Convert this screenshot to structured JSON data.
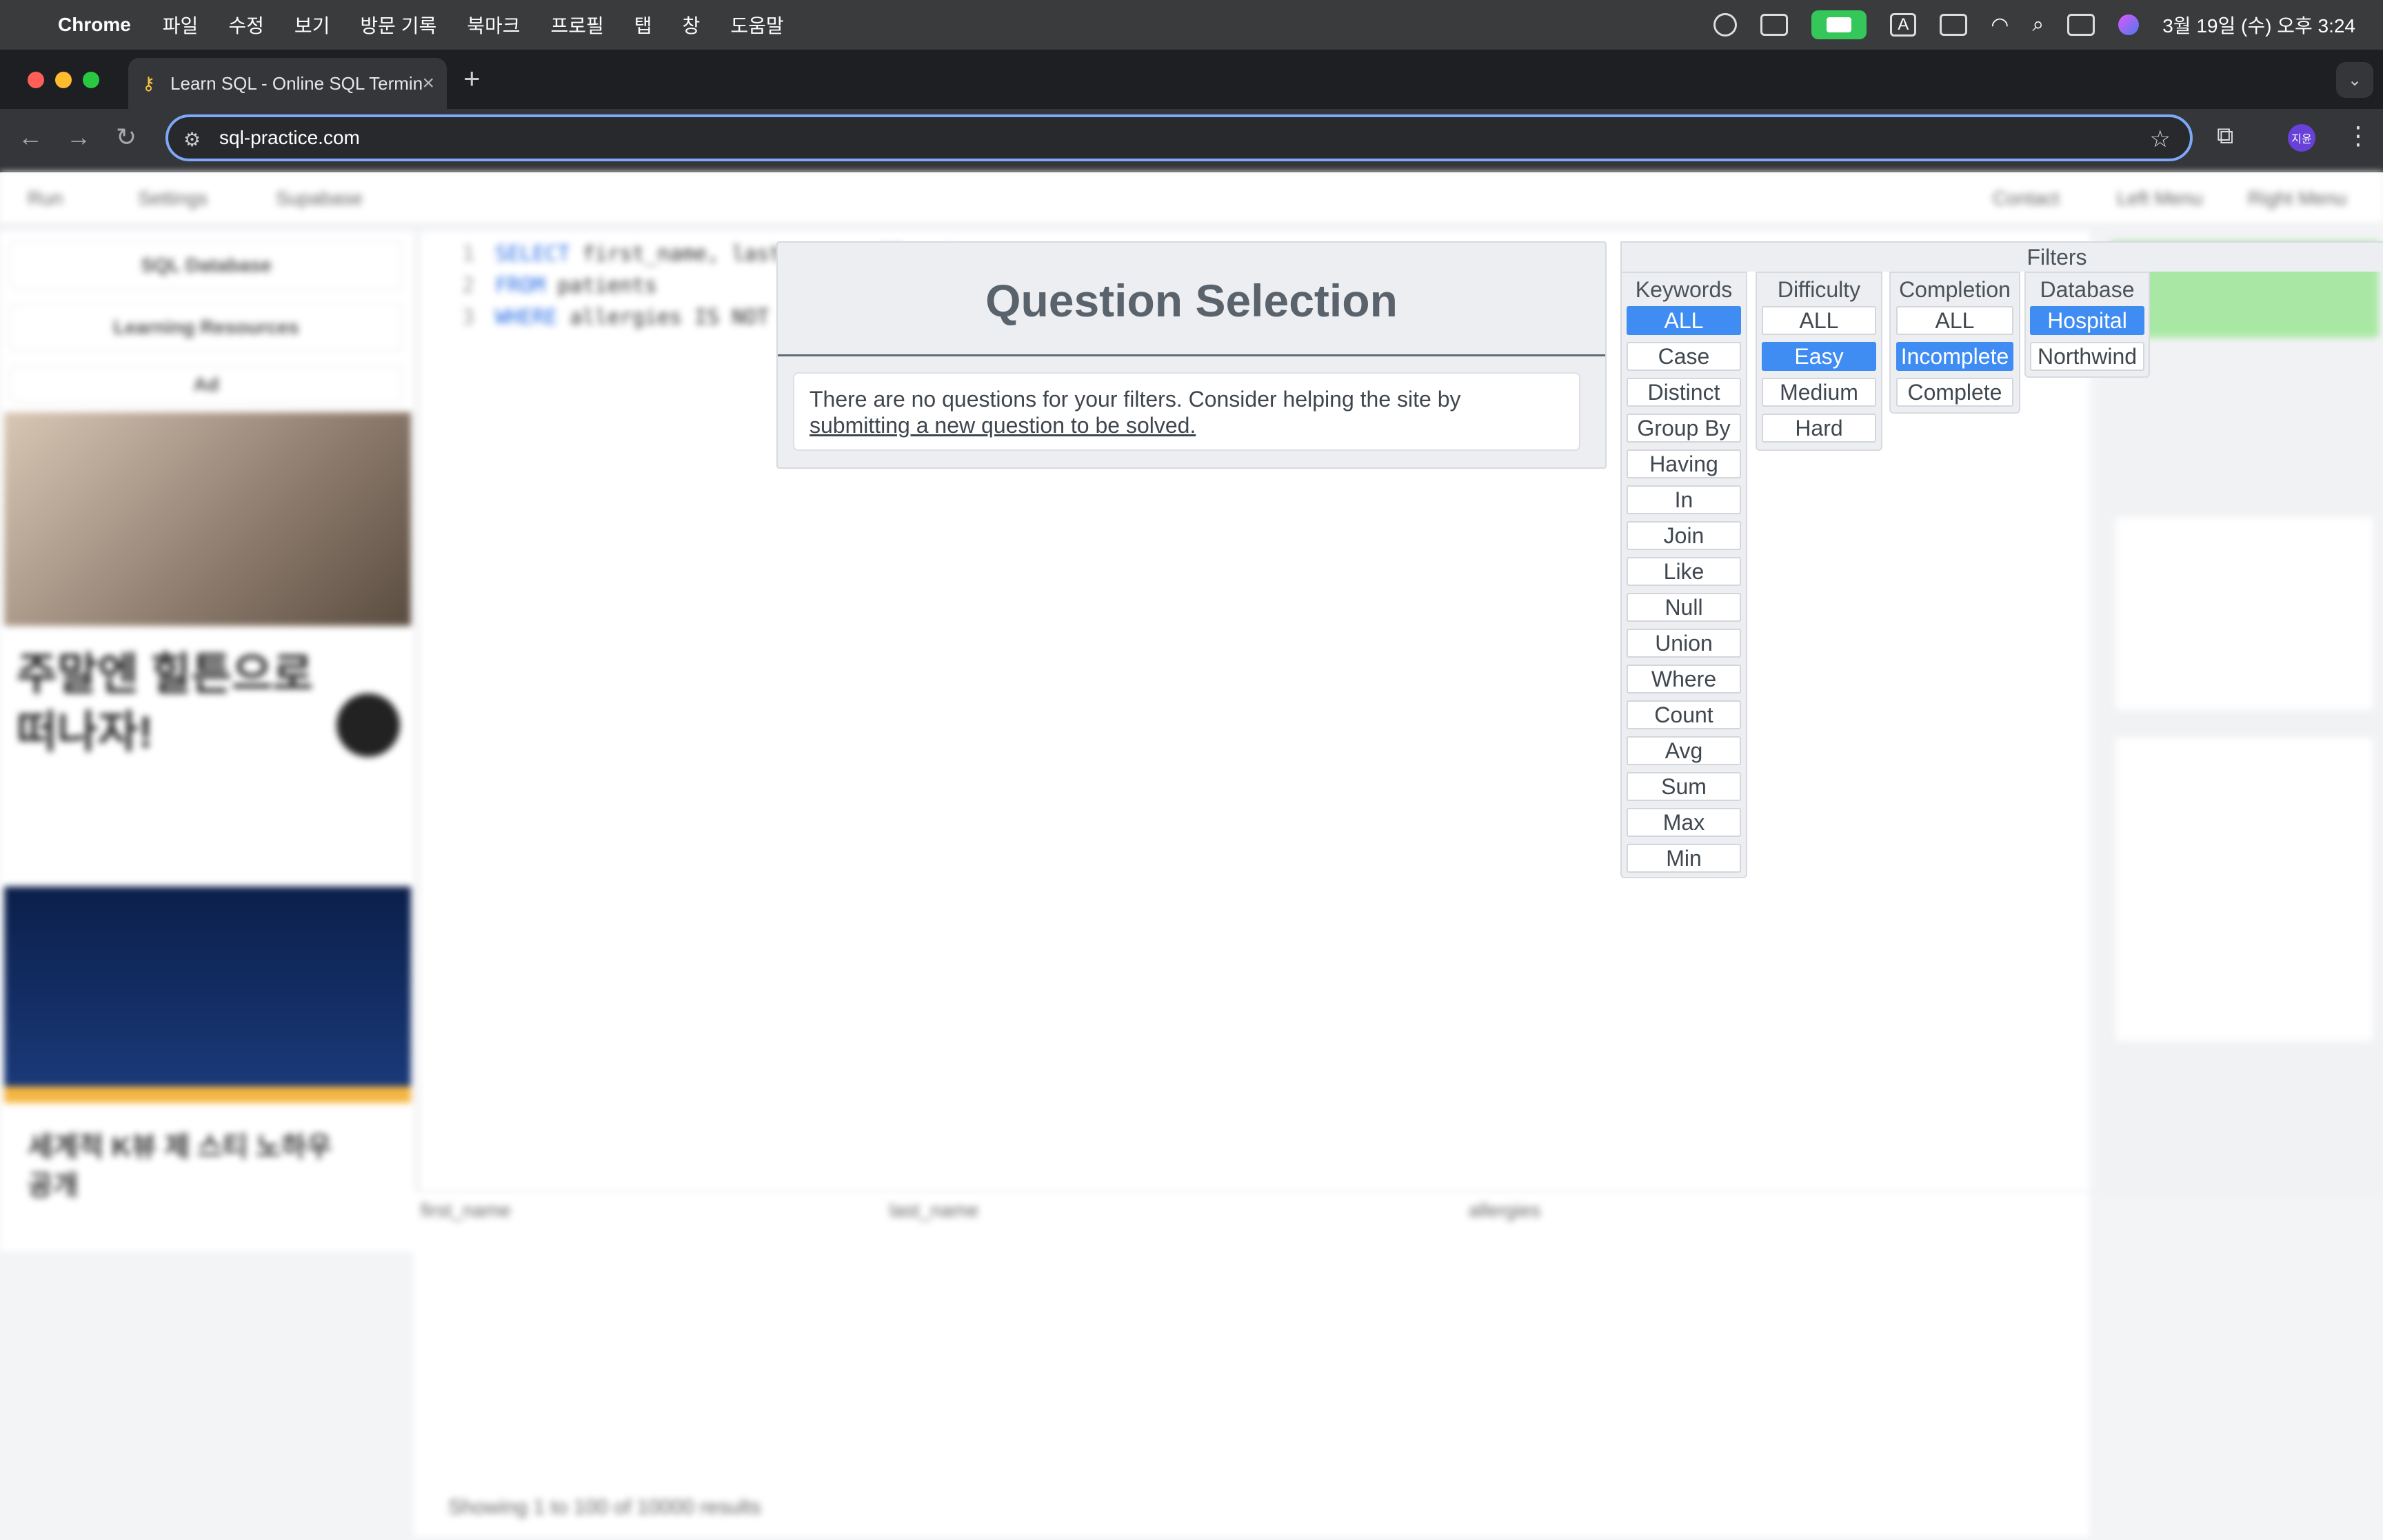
{
  "menubar": {
    "app_name": "Chrome",
    "items": [
      "파일",
      "수정",
      "보기",
      "방문 기록",
      "북마크",
      "프로필",
      "탭",
      "창",
      "도움말"
    ],
    "clock": "3월 19일 (수) 오후 3:24",
    "input_indicator": "A"
  },
  "browser": {
    "tab_title": "Learn SQL - Online SQL Terminal",
    "url": "sql-practice.com",
    "profile_initials": "지윤"
  },
  "background_page": {
    "nav_items": [
      "Run",
      "Settings",
      "Supabase",
      "Contact",
      "Left Menu",
      "Right Menu"
    ],
    "left_buttons": [
      "SQL Database",
      "Learning Resources",
      "Ad"
    ],
    "code_lines": [
      {
        "num": "1",
        "kw": "SELECT",
        "rest": " first_name, last_name, allergies"
      },
      {
        "num": "2",
        "kw": "FROM",
        "rest": " patients"
      },
      {
        "num": "3",
        "kw": "WHERE",
        "rest": " allergies IS NOT NULL"
      }
    ],
    "results_columns": [
      "first_name",
      "last_name",
      "allergies"
    ],
    "results_footer": "Showing 1 to 100 of 10000 results"
  },
  "question_selection": {
    "title": "Question Selection",
    "message": "There are no questions for your filters. Consider helping the site by",
    "link_text": "submitting a new question to be solved."
  },
  "filters": {
    "title": "Filters",
    "columns": [
      {
        "heading": "Keywords",
        "options": [
          "ALL",
          "Case",
          "Distinct",
          "Group By",
          "Having",
          "In",
          "Join",
          "Like",
          "Null",
          "Union",
          "Where",
          "Count",
          "Avg",
          "Sum",
          "Max",
          "Min"
        ],
        "selected": [
          "ALL"
        ]
      },
      {
        "heading": "Difficulty",
        "options": [
          "ALL",
          "Easy",
          "Medium",
          "Hard"
        ],
        "selected": [
          "Easy"
        ]
      },
      {
        "heading": "Completion",
        "options": [
          "ALL",
          "Incomplete",
          "Complete"
        ],
        "selected": [
          "Incomplete"
        ]
      },
      {
        "heading": "Database",
        "options": [
          "Hospital",
          "Northwind"
        ],
        "selected": [
          "Hospital"
        ]
      }
    ]
  },
  "colors": {
    "selected_filter": "#3f8cf2",
    "panel_bg": "#eceef1",
    "title_text": "#5a636c"
  }
}
